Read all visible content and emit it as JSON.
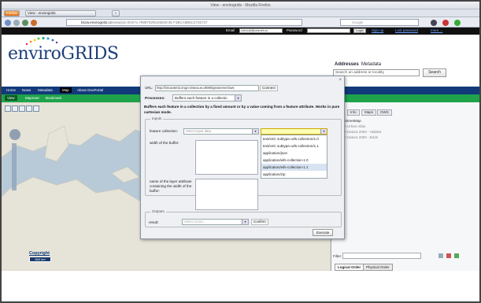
{
  "browser": {
    "window_title": "View - envirogrids - Mozilla Firefox",
    "menu_button": "Firefox",
    "tab_title": "View - envirogrids",
    "url_domain": "bscw.envirogrids.cz",
    "url_path": "/view/join.html?i=7998702f6193849 8b F3BCA8B5C2745727",
    "search_placeholder": "Google"
  },
  "site_top": {
    "email_label": "Email",
    "email_value": "votnout@cesnet.cz",
    "password_label": "Password",
    "login_button": "Login",
    "links": [
      "Sign up",
      "Lost password",
      "more ..."
    ]
  },
  "header": {
    "logo_text": "enviroGRIDS",
    "addresses_label": "Addresses",
    "metadata_label": "Metadata",
    "address_placeholder": "Search an address or locality",
    "search_button": "Search"
  },
  "nav_primary": [
    "Home",
    "News",
    "Metadata",
    "Map",
    "About GeoPortal"
  ],
  "nav_primary_active": "Map",
  "nav_secondary": [
    "View",
    "Mapmart",
    "Bookmark"
  ],
  "nav_secondary_active": "View",
  "map": {
    "copyright": "Copyright",
    "scale": "500 km"
  },
  "right_panel": {
    "tabs": [
      "Info",
      "Maps",
      "OWS"
    ],
    "layers": [
      "OpenStreetMap",
      "BSA Urban Atlas",
      "BSA Natura 2000 - Habitat",
      "BSA Natura 2000 - Birds"
    ],
    "filter_label": "Filter:",
    "bottom_tabs": [
      "Logical Order",
      "Physical Order"
    ]
  },
  "dialog": {
    "url_label": "URL:",
    "url_value": "http://bricante02.imgr.ro/weia.eu:8080/geoserver/ows",
    "connect_button": "Connect",
    "processes_label": "Processes:",
    "process_value": "Buffers each feature in a collectio",
    "description": "Buffers each feature in a collection by a fixed amount or by a value coming from a feature attribute. Works in pure cartesian mode.",
    "inputs_legend": "Inputs",
    "feature_collection_label": "feature collection:",
    "feature_collection_placeholder": "Select input data",
    "mime_value": "",
    "mime_options": [
      "text/xml; subtype=wfs-collection/1.0",
      "text/xml; subtype=wfs-collection/1.1",
      "application/json",
      "application/wfs-collection-1.0",
      "application/wfs-collection-1.1",
      "application/zip"
    ],
    "mime_selected_index": 4,
    "width_label": "width of the buffer:",
    "attr_label": "name of the layer attribute containing the width of the buffer:",
    "outputs_legend": "Outputs",
    "result_label": "result:",
    "result_placeholder": "Select action",
    "confirm_button": "Confirm",
    "execute_button": "Execute"
  },
  "colors": {
    "nav_primary": "#123a7a",
    "nav_secondary": "#1ea34a",
    "map_sea": "#b8cad7",
    "map_land": "#e6e3d8"
  }
}
